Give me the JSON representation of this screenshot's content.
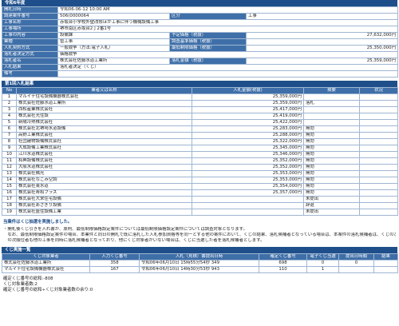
{
  "year_header": "令和6年度",
  "info": {
    "opening_date": {
      "label": "開札日時",
      "value": "令和06-06-12 10:00 AM"
    },
    "subject_no": {
      "label": "調達案件番号",
      "value": "506(0000064",
      "right_label": "区分",
      "right_value": "工事"
    },
    "project_name": {
      "label": "工事名称",
      "value": "赤坂台小学校外壁改修ほか工事に伴う機械設備工事"
    },
    "location": {
      "label": "工事場所",
      "value": "堺市南区赤坂台2丁2番1号"
    },
    "period": {
      "label": "工事の内容",
      "value": "設備課",
      "right_label": "予定価格（税抜）",
      "right_value": "27,632,000円"
    },
    "type": {
      "label": "業種",
      "value": "管工事",
      "right_label": "調査基準価格（税抜）",
      "right_value": ""
    },
    "method": {
      "label": "入札契約方式",
      "value": "一般競争（方法:電子入札）",
      "right_label": "最低制限価格（税抜）",
      "right_value": "25,350,000円"
    },
    "decision_method": {
      "label": "落札者決定方式",
      "value": "価格競争"
    },
    "winner": {
      "label": "落札者名",
      "value": "株式会社佐藤水道工業所",
      "right_label": "落札金額（税抜）",
      "right_value": "25,359,000円"
    },
    "result": {
      "label": "入札結果",
      "value": "落札者決定（くじ）"
    },
    "remarks": {
      "label": "備考",
      "value": ""
    }
  },
  "round_title": "第1回入札結果",
  "bid_table": {
    "headers": [
      "No",
      "業者又は名称",
      "入札金額(税抜)",
      "摘要",
      "状況"
    ],
    "rows": [
      {
        "no": "1",
        "name": "マルイチ住宅設備機器株式会社",
        "amount": "25,359,000円",
        "note": "",
        "status": ""
      },
      {
        "no": "2",
        "name": "株式会社佐藤水道工業所",
        "amount": "25,359,000円",
        "note": "落札",
        "status": ""
      },
      {
        "no": "3",
        "name": "西松産業株式会社",
        "amount": "25,417,000円",
        "note": "",
        "status": ""
      },
      {
        "no": "4",
        "name": "株式会社光住設",
        "amount": "25,419,000円",
        "note": "",
        "status": ""
      },
      {
        "no": "5",
        "name": "新陽冷熱株式会社",
        "amount": "25,422,000円",
        "note": "",
        "status": ""
      },
      {
        "no": "6",
        "name": "株式会社北堺埼水道設備",
        "amount": "25,283,000円",
        "note": "無効",
        "status": ""
      },
      {
        "no": "7",
        "name": "高野工業株式会社",
        "amount": "25,288,000円",
        "note": "無効",
        "status": ""
      },
      {
        "no": "8",
        "name": "社団建物設備株式会社",
        "amount": "25,322,000円",
        "note": "無効",
        "status": ""
      },
      {
        "no": "9",
        "name": "大成設備工業株式会社",
        "amount": "25,345,000円",
        "note": "無効",
        "status": ""
      },
      {
        "no": "10",
        "name": "江川水道株式会社",
        "amount": "25,346,000円",
        "note": "無効",
        "status": ""
      },
      {
        "no": "11",
        "name": "和興設備株式会社",
        "amount": "25,352,000円",
        "note": "無効",
        "status": ""
      },
      {
        "no": "12",
        "name": "大阪水道株式会社",
        "amount": "25,352,000円",
        "note": "無効",
        "status": ""
      },
      {
        "no": "13",
        "name": "株式会社備光",
        "amount": "25,353,000円",
        "note": "無効",
        "status": ""
      },
      {
        "no": "14",
        "name": "株式会社なごみ空調",
        "amount": "25,353,000円",
        "note": "無効",
        "status": ""
      },
      {
        "no": "15",
        "name": "株式会社東水道",
        "amount": "25,354,000円",
        "note": "無効",
        "status": ""
      },
      {
        "no": "16",
        "name": "株式会社寿和プラス",
        "amount": "25,357,000円",
        "note": "無効",
        "status": ""
      },
      {
        "no": "17",
        "name": "株式会社大栄住宅設備",
        "amount": "",
        "note": "未提出",
        "status": ""
      },
      {
        "no": "18",
        "name": "株式会社あさぎり設備",
        "amount": "",
        "note": "辞退",
        "status": ""
      },
      {
        "no": "19",
        "name": "株式会社盛住設備工業",
        "amount": "",
        "note": "未提出",
        "status": ""
      }
    ]
  },
  "notes": {
    "title": "当業件はくじ抽選を実施しました。",
    "lines": [
      "・開札後くじ引きを入れ書が、原則、最低制限価格設定案件については最低制限価格設定案件については調査対象となります。",
      "　なお、最低制限価格設定案件の場合、本業件と同日の開札で既に落札した入札参加資格等を同一とする他の案件において、くじの結果、落札候補者となっている場合は、本案件の落札候補者は、くじの次順位者となります。ただし、くじ",
      "　の次順位者も他の工事を同時に落札候補者となっており、他にくじ対象者がいない場合は、くじに当選した者を落札候補者とします。"
    ]
  },
  "lottery_bar": "くじ実施一覧",
  "lottery_table": {
    "headers": [
      "くじ対象業者",
      "入力くじ番号",
      "入札（見積）書提出日時",
      "確定くじ番号",
      "電子くじ当選",
      "提出日時順",
      "結果"
    ],
    "rows": [
      {
        "name": "株式会社佐藤水道工業所",
        "input": "358",
        "time": "令和06年06月10日 15時55分54秒 349",
        "fixed": "698",
        "lot": "0",
        "order": "0",
        "result": ""
      },
      {
        "name": "マルイチ住宅設備機器株式会社",
        "input": "167",
        "time": "令和06年06月10日 14時30分53秒 943",
        "fixed": "110",
        "lot": "1",
        "order": "",
        "result": ""
      }
    ]
  },
  "footer": [
    "確定くじ番号の総和:-808",
    "くじ対象業者数:2",
    "確定くじ番号の総和÷くじ対象業者数の余り:0"
  ]
}
